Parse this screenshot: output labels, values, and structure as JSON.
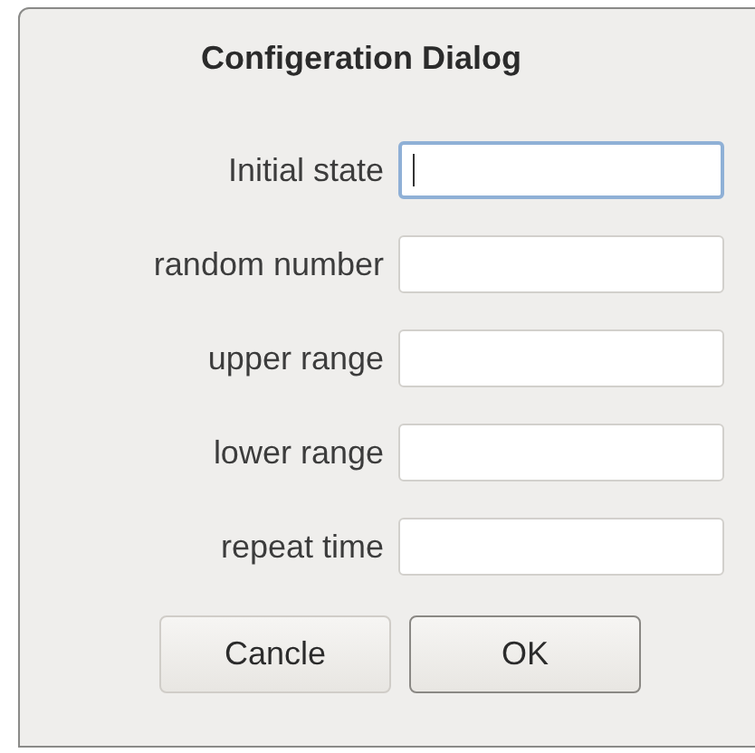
{
  "dialog": {
    "title": "Configeration Dialog"
  },
  "fields": [
    {
      "label": "Initial state",
      "focused": true
    },
    {
      "label": "random number",
      "focused": false
    },
    {
      "label": "upper range",
      "focused": false
    },
    {
      "label": "lower range",
      "focused": false
    },
    {
      "label": "repeat time",
      "focused": false
    }
  ],
  "buttons": [
    {
      "label": "Cancle",
      "default": false
    },
    {
      "label": "OK",
      "default": true
    }
  ]
}
